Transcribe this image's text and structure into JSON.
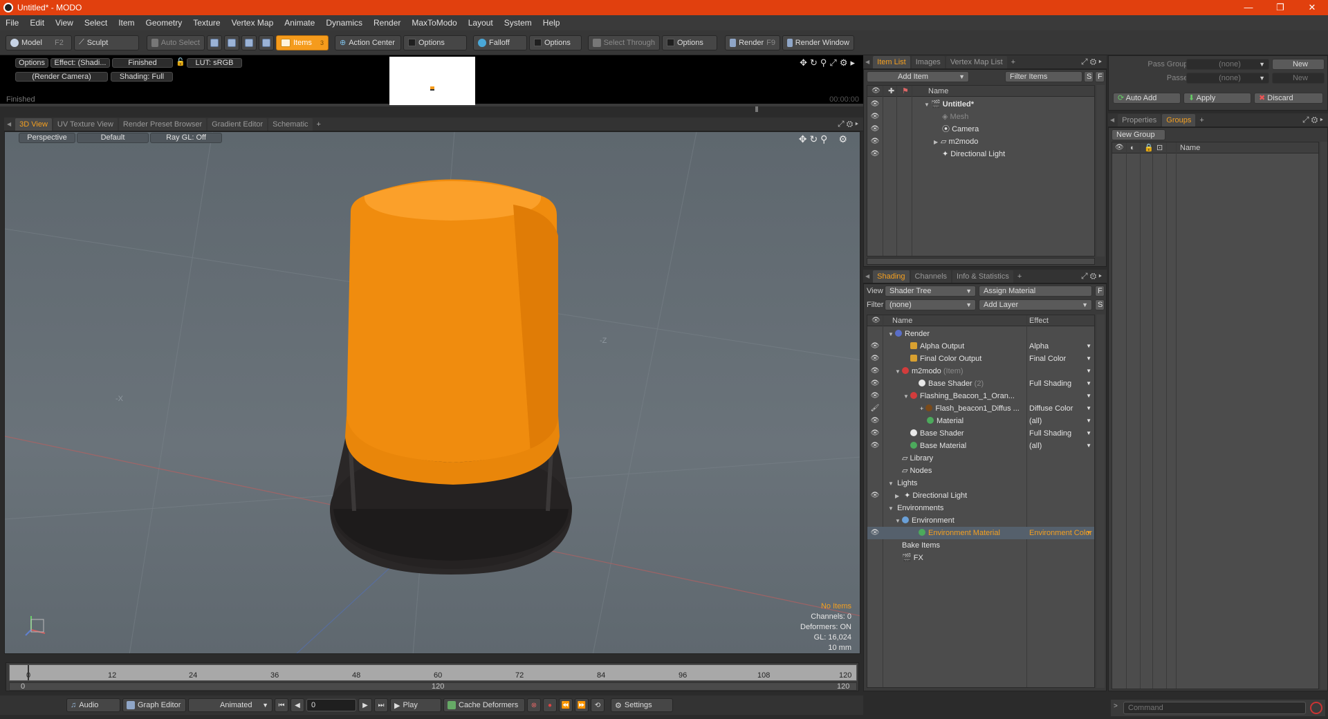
{
  "window": {
    "title": "Untitled* - MODO",
    "minimize": "—",
    "restore": "❐",
    "close": "✕"
  },
  "menu": [
    "File",
    "Edit",
    "View",
    "Select",
    "Item",
    "Geometry",
    "Texture",
    "Vertex Map",
    "Animate",
    "Dynamics",
    "Render",
    "MaxToModo",
    "Layout",
    "System",
    "Help"
  ],
  "toolbar": {
    "model": "Model",
    "model_key": "F2",
    "sculpt": "Sculpt",
    "auto_select": "Auto Select",
    "items": "Items",
    "items_key": "3",
    "action_center": "Action Center",
    "options1": "Options",
    "falloff": "Falloff",
    "options2": "Options",
    "select_through": "Select Through",
    "options3": "Options",
    "render": "Render",
    "render_key": "F9",
    "render_window": "Render Window"
  },
  "preview": {
    "options": "Options",
    "effect": "Effect: (Shadi...",
    "finished_btn": "Finished",
    "lut": "LUT: sRGB",
    "camera": "(Render Camera)",
    "shading": "Shading: Full",
    "status": "Finished",
    "time": "00:00:00"
  },
  "viewport_tabs": [
    "3D View",
    "UV Texture View",
    "Render Preset Browser",
    "Gradient Editor",
    "Schematic"
  ],
  "viewport": {
    "perspective": "Perspective",
    "default": "Default",
    "raygl": "Ray GL: Off",
    "axis_x": "-X",
    "axis_z": "-Z",
    "stats": {
      "items": "No Items",
      "channels": "Channels: 0",
      "deformers": "Deformers: ON",
      "gl": "GL: 16,024",
      "scale": "10 mm"
    }
  },
  "timeline": {
    "ticks": [
      "0",
      "12",
      "24",
      "36",
      "48",
      "60",
      "72",
      "84",
      "96",
      "108",
      "120"
    ],
    "range_start": "0",
    "range_mid": "120",
    "range_end": "120"
  },
  "transport": {
    "audio": "Audio",
    "graph_editor": "Graph Editor",
    "animated": "Animated",
    "frame": "0",
    "play": "Play",
    "cache_deformers": "Cache Deformers",
    "settings": "Settings"
  },
  "item_list": {
    "tabs": [
      "Item List",
      "Images",
      "Vertex Map List"
    ],
    "add_item": "Add Item",
    "filter_items": "Filter Items",
    "s": "S",
    "f": "F",
    "col_name": "Name",
    "items": [
      {
        "name": "Untitled*",
        "level": 0
      },
      {
        "name": "Mesh",
        "level": 1,
        "dim": true
      },
      {
        "name": "Camera",
        "level": 1
      },
      {
        "name": "m2modo",
        "level": 1
      },
      {
        "name": "Directional Light",
        "level": 1
      }
    ]
  },
  "shading": {
    "tabs": [
      "Shading",
      "Channels",
      "Info & Statistics"
    ],
    "view_label": "View",
    "view_value": "Shader Tree",
    "assign_material": "Assign Material",
    "f": "F",
    "filter_label": "Filter",
    "filter_value": "(none)",
    "add_layer": "Add Layer",
    "s": "S",
    "col_name": "Name",
    "col_effect": "Effect",
    "rows": [
      {
        "name": "Render",
        "effect": "",
        "level": 0
      },
      {
        "name": "Alpha Output",
        "effect": "Alpha",
        "level": 1
      },
      {
        "name": "Final Color Output",
        "effect": "Final Color",
        "level": 1
      },
      {
        "name": "m2modo",
        "suffix": "(Item)",
        "effect": "",
        "level": 1
      },
      {
        "name": "Base Shader",
        "suffix": "(2)",
        "effect": "Full Shading",
        "level": 2
      },
      {
        "name": "Flashing_Beacon_1_Oran...",
        "effect": "",
        "level": 2
      },
      {
        "name": "Flash_beacon1_Diffus ...",
        "effect": "Diffuse Color",
        "level": 3
      },
      {
        "name": "Material",
        "effect": "(all)",
        "level": 3
      },
      {
        "name": "Base Shader",
        "effect": "Full Shading",
        "level": 1
      },
      {
        "name": "Base Material",
        "effect": "(all)",
        "level": 1
      },
      {
        "name": "Library",
        "effect": "",
        "level": 0
      },
      {
        "name": "Nodes",
        "effect": "",
        "level": 0
      },
      {
        "name": "Lights",
        "effect": "",
        "level": 0
      },
      {
        "name": "Directional Light",
        "effect": "",
        "level": 1
      },
      {
        "name": "Environments",
        "effect": "",
        "level": 0
      },
      {
        "name": "Environment",
        "effect": "",
        "level": 1
      },
      {
        "name": "Environment Material",
        "effect": "Environment Color",
        "level": 2,
        "selected": true
      },
      {
        "name": "Bake Items",
        "effect": "",
        "level": 0
      },
      {
        "name": "FX",
        "effect": "",
        "level": 0
      }
    ]
  },
  "groups": {
    "pass_groups_label": "Pass Groups",
    "pass_groups_value": "(none)",
    "new": "New",
    "passes_label": "Passes",
    "passes_value": "(none)",
    "new2": "New",
    "auto_add": "Auto Add",
    "apply": "Apply",
    "discard": "Discard",
    "tabs": [
      "Properties",
      "Groups"
    ],
    "new_group": "New Group",
    "col_name": "Name"
  },
  "command": {
    "placeholder": "Command"
  },
  "colors": {
    "accent": "#f5a020",
    "titlebar": "#e1400e",
    "beacon_orange": "#f59b1c",
    "beacon_base": "#2a2727"
  }
}
